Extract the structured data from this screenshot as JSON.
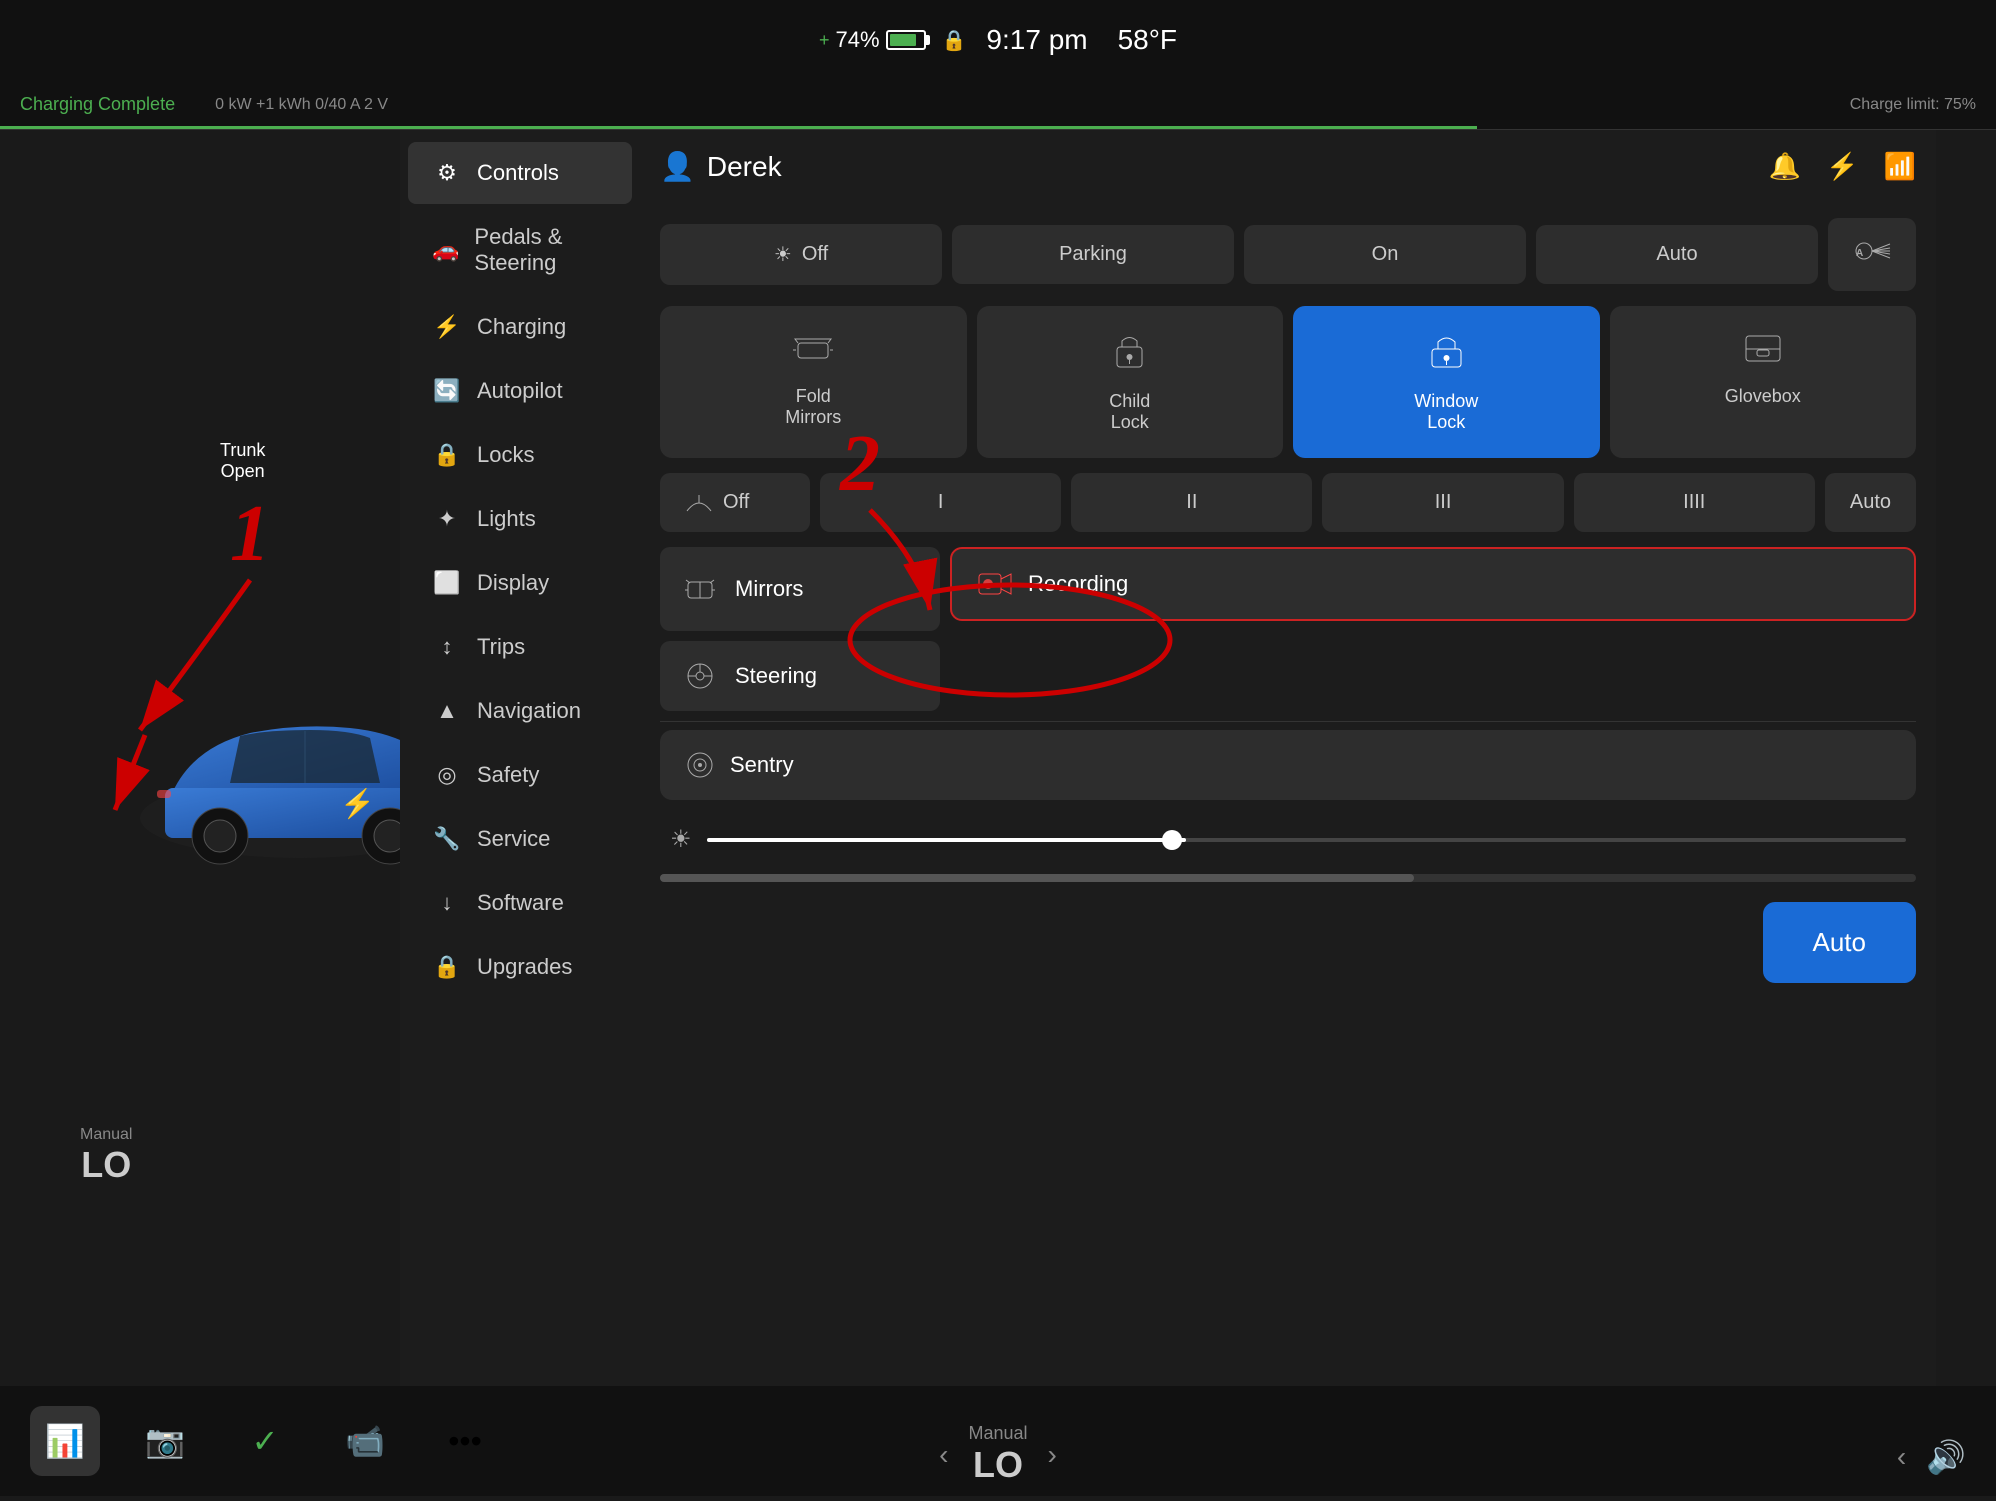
{
  "statusBar": {
    "battery": "74%",
    "time": "9:17 pm",
    "temperature": "58°F"
  },
  "chargingBar": {
    "title": "Charging Complete",
    "stats": "0 kW  +1 kWh  0/40 A  2 V",
    "chargeLimit": "Charge limit: 75%"
  },
  "sidebar": {
    "items": [
      {
        "id": "controls",
        "icon": "⚙",
        "label": "Controls",
        "active": true
      },
      {
        "id": "pedals",
        "icon": "🚗",
        "label": "Pedals & Steering"
      },
      {
        "id": "charging",
        "icon": "⚡",
        "label": "Charging"
      },
      {
        "id": "autopilot",
        "icon": "🔄",
        "label": "Autopilot"
      },
      {
        "id": "locks",
        "icon": "🔒",
        "label": "Locks"
      },
      {
        "id": "lights",
        "icon": "✦",
        "label": "Lights"
      },
      {
        "id": "display",
        "icon": "⬜",
        "label": "Display"
      },
      {
        "id": "trips",
        "icon": "↕",
        "label": "Trips"
      },
      {
        "id": "navigation",
        "icon": "▲",
        "label": "Navigation"
      },
      {
        "id": "safety",
        "icon": "◎",
        "label": "Safety"
      },
      {
        "id": "service",
        "icon": "🔧",
        "label": "Service"
      },
      {
        "id": "software",
        "icon": "↓",
        "label": "Software"
      },
      {
        "id": "upgrades",
        "icon": "🔒",
        "label": "Upgrades"
      }
    ]
  },
  "header": {
    "userName": "Derek",
    "userIcon": "👤",
    "bellIcon": "🔔",
    "bluetoothIcon": "⚡",
    "wifiIcon": "📶"
  },
  "lightsSection": {
    "buttons": [
      {
        "id": "off",
        "label": "Off",
        "icon": "☀",
        "active": false
      },
      {
        "id": "parking",
        "label": "Parking",
        "active": false
      },
      {
        "id": "on",
        "label": "On",
        "active": false
      },
      {
        "id": "auto",
        "label": "Auto",
        "active": false
      }
    ],
    "autoIconLabel": "A"
  },
  "controlsGrid": [
    {
      "id": "fold-mirrors",
      "icon": "⬛",
      "label": "Fold\nMirrors",
      "active": false
    },
    {
      "id": "child-lock",
      "icon": "🔒",
      "label": "Child\nLock",
      "active": false
    },
    {
      "id": "window-lock",
      "icon": "🔒",
      "label": "Window\nLock",
      "active": true
    },
    {
      "id": "glovebox",
      "icon": "⬛",
      "label": "Glovebox",
      "active": false
    }
  ],
  "wipers": {
    "offLabel": "Off",
    "speeds": [
      "I",
      "II",
      "III",
      "IIII"
    ],
    "autoLabel": "Auto"
  },
  "mirrorsRow": {
    "icon": "⬛",
    "label": "Mirrors"
  },
  "recordingRow": {
    "icon": "📹",
    "label": "Recording"
  },
  "steeringRow": {
    "icon": "🔄",
    "label": "Steering"
  },
  "sentryRow": {
    "icon": "◎",
    "label": "Sentry"
  },
  "brightness": {
    "sunIcon": "☀",
    "value": 40
  },
  "autoButton": {
    "label": "Auto"
  },
  "bottomNav": {
    "items": [
      {
        "id": "bar-chart",
        "icon": "📊",
        "active": true
      },
      {
        "id": "camera",
        "icon": "📷"
      },
      {
        "id": "check",
        "icon": "✓",
        "active": false
      },
      {
        "id": "dashcam",
        "icon": "📹"
      },
      {
        "id": "dots",
        "icon": "•••"
      }
    ]
  },
  "manualLo": {
    "label": "Manual",
    "value": "LO"
  },
  "trunkIndicators": [
    {
      "label": "Trunk\nOpen",
      "position": "top"
    },
    {
      "label": "Trunk\nOpen",
      "position": "bottom"
    }
  ],
  "annotations": {
    "number1": "1",
    "number2": "2"
  }
}
